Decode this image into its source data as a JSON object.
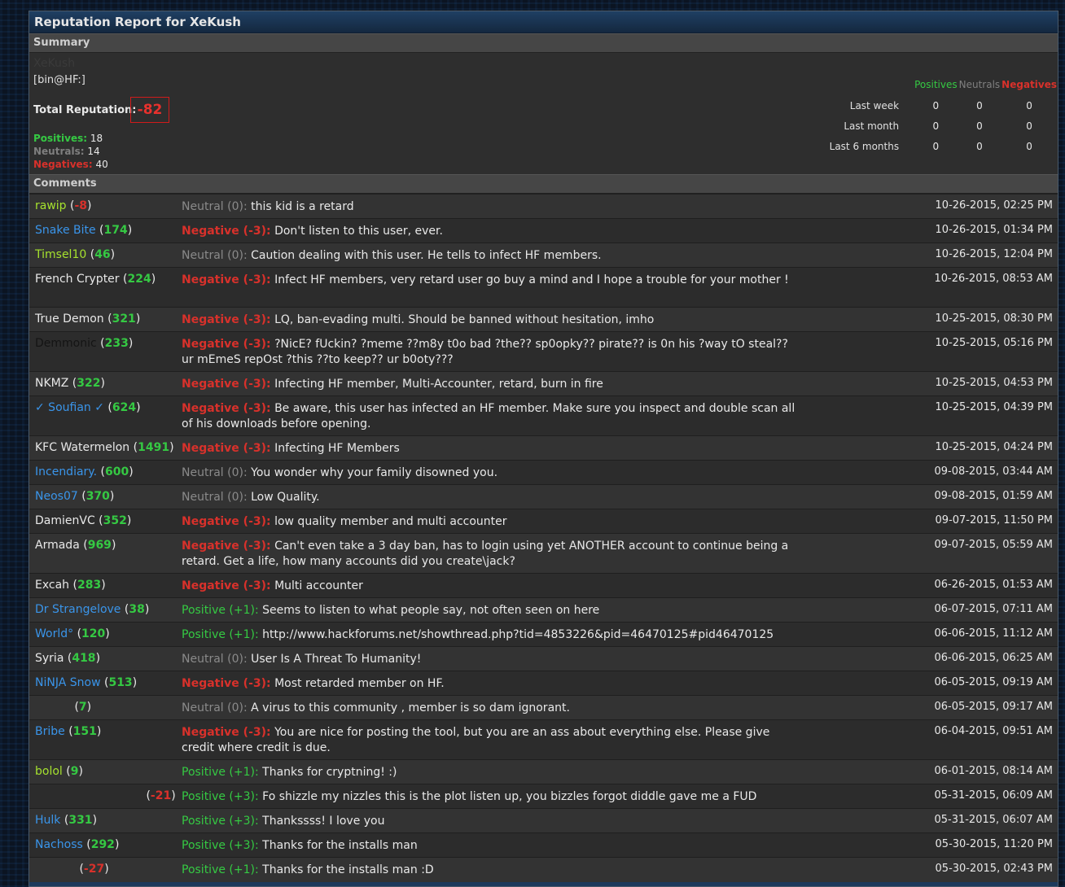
{
  "title": "Reputation Report for XeKush",
  "summary": {
    "header": "Summary",
    "username": "XeKush",
    "user_title": "[bin@HF:]",
    "total_label": "Total Reputation:",
    "total_value": "-82",
    "positives_label": "Positives:",
    "positives_count": "18",
    "neutrals_label": "Neutrals:",
    "neutrals_count": "14",
    "negatives_label": "Negatives:",
    "negatives_count": "40",
    "stats_headers": {
      "positives": "Positives",
      "neutrals": "Neutrals",
      "negatives": "Negatives"
    },
    "stats_rows": [
      {
        "label": "Last week",
        "pos": "0",
        "neu": "0",
        "neg": "0"
      },
      {
        "label": "Last month",
        "pos": "0",
        "neu": "0",
        "neg": "0"
      },
      {
        "label": "Last 6 months",
        "pos": "0",
        "neu": "0",
        "neg": "0"
      }
    ]
  },
  "comments_header": "Comments",
  "comments": [
    {
      "user": "rawip",
      "rep": "-8",
      "rep_neg": true,
      "ucolor": "green",
      "rating": "Neutral (0):",
      "rtype": "neu",
      "text": "this kid is a retard",
      "date": "10-26-2015, 02:25 PM"
    },
    {
      "user": "Snake Bite",
      "rep": "174",
      "ucolor": "blue",
      "rating": "Negative (-3):",
      "rtype": "neg",
      "text": "Don't listen to this user, ever.",
      "date": "10-26-2015, 01:34 PM"
    },
    {
      "user": "Timsel10",
      "rep": "46",
      "ucolor": "green",
      "rating": "Neutral (0):",
      "rtype": "neu",
      "text": "Caution dealing with this user. He tells to infect HF members.",
      "date": "10-26-2015, 12:04 PM"
    },
    {
      "user": "French Crypter",
      "rep": "224",
      "ucolor": "white",
      "rating": "Negative (-3):",
      "rtype": "neg",
      "text": "Infect HF members, very retard user go buy a mind and I hope a trouble for your mother !",
      "date": "10-26-2015, 08:53 AM",
      "tall": true
    },
    {
      "user": "True Demon",
      "rep": "321",
      "ucolor": "white",
      "rating": "Negative (-3):",
      "rtype": "neg",
      "text": "LQ, ban-evading multi. Should be banned without hesitation, imho",
      "date": "10-25-2015, 08:30 PM"
    },
    {
      "user": "Demmonic",
      "rep": "233",
      "ucolor": "dark",
      "rating": "Negative (-3):",
      "rtype": "neg",
      "text": "?NicE? fUckin? ?meme ??m8y t0o bad ?the?? sp0opky?? pirate?? is 0n his ?way tO steal?? ur mEmeS repOst ?this ??to keep?? ur b0oty???",
      "date": "10-25-2015, 05:16 PM",
      "tall": true
    },
    {
      "user": "NKMZ",
      "rep": "322",
      "ucolor": "white",
      "rating": "Negative (-3):",
      "rtype": "neg",
      "text": "Infecting HF member, Multi-Accounter, retard, burn in fire",
      "date": "10-25-2015, 04:53 PM"
    },
    {
      "user": "✓ Soufian ✓",
      "rep": "624",
      "ucolor": "blue",
      "rating": "Negative (-3):",
      "rtype": "neg",
      "text": "Be aware, this user has infected an HF member. Make sure you inspect and double scan all of his downloads before opening.",
      "date": "10-25-2015, 04:39 PM",
      "tall": true
    },
    {
      "user": "KFC Watermelon",
      "rep": "1491",
      "ucolor": "white",
      "rating": "Negative (-3):",
      "rtype": "neg",
      "text": "Infecting HF Members",
      "date": "10-25-2015, 04:24 PM"
    },
    {
      "user": "Incendiary.",
      "rep": "600",
      "ucolor": "blue",
      "rating": "Neutral (0):",
      "rtype": "neu",
      "text": "You wonder why your family disowned you.",
      "date": "09-08-2015, 03:44 AM"
    },
    {
      "user": "Neos07",
      "rep": "370",
      "ucolor": "blue",
      "rating": "Neutral (0):",
      "rtype": "neu",
      "text": "Low Quality.",
      "date": "09-08-2015, 01:59 AM"
    },
    {
      "user": "DamienVC",
      "rep": "352",
      "ucolor": "white",
      "rating": "Negative (-3):",
      "rtype": "neg",
      "text": "low quality member and multi accounter",
      "date": "09-07-2015, 11:50 PM"
    },
    {
      "user": "Armada",
      "rep": "969",
      "ucolor": "white",
      "rating": "Negative (-3):",
      "rtype": "neg",
      "text": "Can't even take a 3 day ban, has to login using yet ANOTHER account to continue being a retard. Get a life, how many accounts did you create\\jack?",
      "date": "09-07-2015, 05:59 AM",
      "tall": true
    },
    {
      "user": "Excah",
      "rep": "283",
      "ucolor": "white",
      "rating": "Negative (-3):",
      "rtype": "neg",
      "text": "Multi accounter",
      "date": "06-26-2015, 01:53 AM"
    },
    {
      "user": "Dr Strangelove",
      "rep": "38",
      "ucolor": "blue",
      "rating": "Positive (+1):",
      "rtype": "pos",
      "text": "Seems to listen to what people say, not often seen on here",
      "date": "06-07-2015, 07:11 AM"
    },
    {
      "user": "World°",
      "rep": "120",
      "ucolor": "blue",
      "rating": "Positive (+1):",
      "rtype": "pos",
      "text": "http://www.hackforums.net/showthread.php?tid=4853226&pid=46470125#pid46470125",
      "date": "06-06-2015, 11:12 AM"
    },
    {
      "user": "Syria",
      "rep": "418",
      "ucolor": "white",
      "rating": "Neutral (0):",
      "rtype": "neu",
      "text": "User Is A Threat To Humanity!",
      "date": "06-06-2015, 06:25 AM"
    },
    {
      "user": "NiNJA Snow",
      "rep": "513",
      "ucolor": "blue",
      "rating": "Negative (-3):",
      "rtype": "neg",
      "text": "Most retarded member on HF.",
      "date": "06-05-2015, 09:19 AM"
    },
    {
      "user": "",
      "rep": "7",
      "ucolor": "dim",
      "rating": "Neutral (0):",
      "rtype": "neu",
      "text": "A virus to this community , member is so dam ignorant.",
      "date": "06-05-2015, 09:17 AM"
    },
    {
      "user": "Bribe",
      "rep": "151",
      "ucolor": "blue",
      "rating": "Negative (-3):",
      "rtype": "neg",
      "text": "You are nice for posting the tool, but you are an ass about everything else. Please give credit where credit is due.",
      "date": "06-04-2015, 09:51 AM",
      "tall": true
    },
    {
      "user": "bolol",
      "rep": "9",
      "ucolor": "green",
      "rating": "Positive (+1):",
      "rtype": "pos",
      "text": "Thanks for cryptning! :)",
      "date": "06-01-2015, 08:14 AM"
    },
    {
      "user": "",
      "rep": "-21",
      "rep_neg": true,
      "ucolor": "dim",
      "rating": "Positive (+3):",
      "rtype": "pos",
      "text": "Fo shizzle my nizzles this is the plot listen up, you bizzles forgot diddle gave me a FUD",
      "date": "05-31-2015, 06:09 AM",
      "rep_right": true
    },
    {
      "user": "Hulk",
      "rep": "331",
      "ucolor": "blue",
      "rating": "Positive (+3):",
      "rtype": "pos",
      "text": "Thankssss! I love you",
      "date": "05-31-2015, 06:07 AM"
    },
    {
      "user": "Nachoss",
      "rep": "292",
      "ucolor": "blue",
      "rating": "Positive (+3):",
      "rtype": "pos",
      "text": "Thanks for the installs man",
      "date": "05-30-2015, 11:20 PM"
    },
    {
      "user": "",
      "rep": "-27",
      "rep_neg": true,
      "ucolor": "dim",
      "rating": "Positive (+1):",
      "rtype": "pos",
      "text": "Thanks for the installs man :D",
      "date": "05-30-2015, 02:43 PM",
      "rep_offset": true
    }
  ]
}
